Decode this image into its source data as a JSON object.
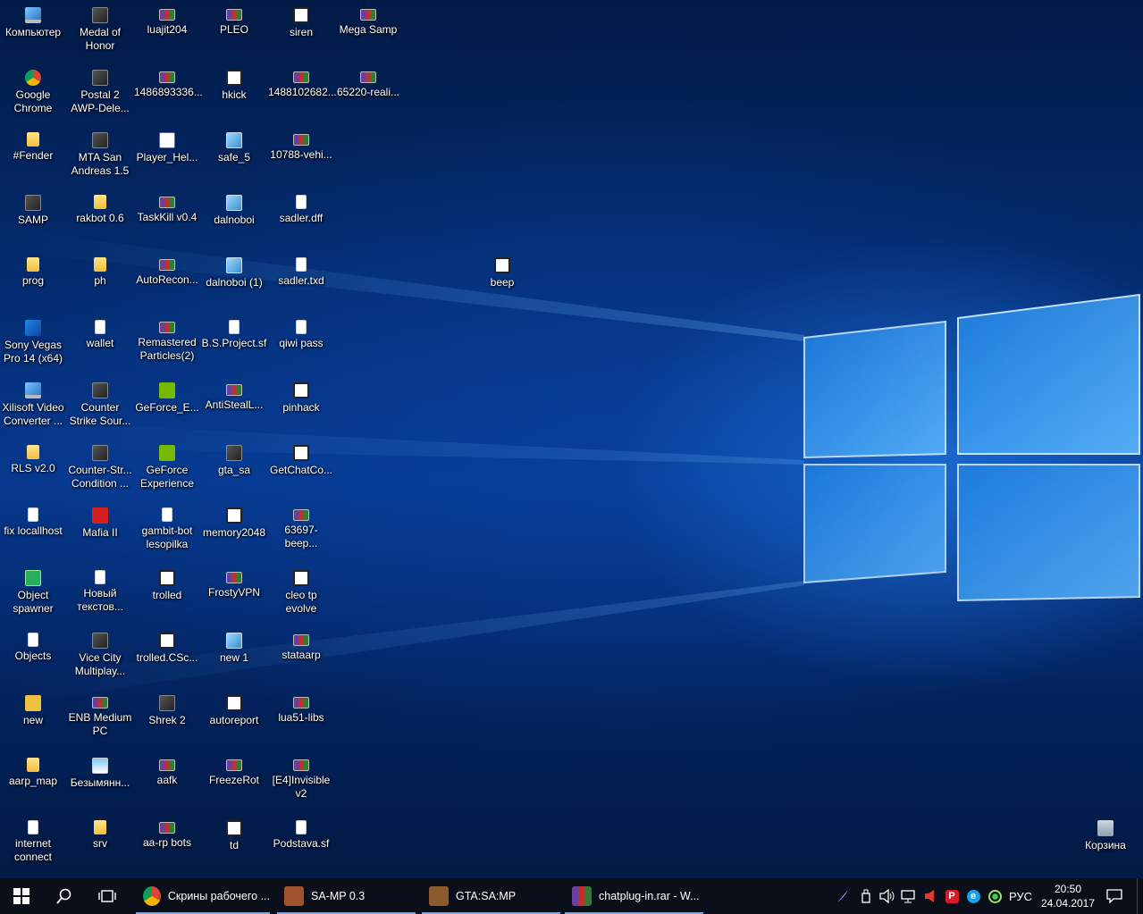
{
  "desktop": {
    "icons": [
      {
        "label": "Компьютер",
        "icon": "computer-icon"
      },
      {
        "label": "Google\nChrome",
        "icon": "chrome-icon"
      },
      {
        "label": "#Fender",
        "icon": "folder-special-icon"
      },
      {
        "label": "SAMP",
        "icon": "samp-game-icon"
      },
      {
        "label": "prog",
        "icon": "folder-icon"
      },
      {
        "label": "Sony Vegas\nPro 14 (x64)",
        "icon": "vegas-icon"
      },
      {
        "label": "Xilisoft Video\nConverter ...",
        "icon": "xilisoft-icon"
      },
      {
        "label": "RLS v2.0",
        "icon": "folder-icon"
      },
      {
        "label": "fix locallhost",
        "icon": "document-icon"
      },
      {
        "label": "Object\nspawner",
        "icon": "green-app-icon"
      },
      {
        "label": "Objects",
        "icon": "document-icon"
      },
      {
        "label": "new",
        "icon": "person-icon"
      },
      {
        "label": "aarp_map",
        "icon": "folder-icon"
      },
      {
        "label": "internet\nconnect",
        "icon": "document-icon"
      },
      {
        "label": "Medal of\nHonor",
        "icon": "game-icon"
      },
      {
        "label": "Postal 2\nAWP-Dele...",
        "icon": "game-icon"
      },
      {
        "label": "MTA San\nAndreas 1.5",
        "icon": "game-icon"
      },
      {
        "label": "rakbot 0.6",
        "icon": "folder-icon"
      },
      {
        "label": "ph",
        "icon": "folder-icon"
      },
      {
        "label": "wallet",
        "icon": "document-icon"
      },
      {
        "label": "Counter\nStrike Sour...",
        "icon": "cs-icon"
      },
      {
        "label": "Counter-Str...\nCondition ...",
        "icon": "cs-icon"
      },
      {
        "label": "Mafia II",
        "icon": "mafia-icon"
      },
      {
        "label": "Новый\nтекстов...",
        "icon": "document-icon"
      },
      {
        "label": "Vice City\nMultiplay...",
        "icon": "game-icon"
      },
      {
        "label": "ENB Medium\nPC",
        "icon": "rar-icon"
      },
      {
        "label": "Безымянн...",
        "icon": "image-icon"
      },
      {
        "label": "srv",
        "icon": "folder-icon"
      },
      {
        "label": "luajit204",
        "icon": "rar-icon"
      },
      {
        "label": "1486893336...",
        "icon": "rar-icon"
      },
      {
        "label": "Player_Hel...",
        "icon": "help-file-icon"
      },
      {
        "label": "TaskKill v0.4",
        "icon": "rar-icon"
      },
      {
        "label": "AutoRecon...",
        "icon": "rar-icon"
      },
      {
        "label": "Remastered\nParticles(2)",
        "icon": "rar-icon"
      },
      {
        "label": "GeForce_E...",
        "icon": "nvidia-icon"
      },
      {
        "label": "GeForce\nExperience",
        "icon": "nvidia-icon"
      },
      {
        "label": "gambit-bot\nlesopilka",
        "icon": "document-icon"
      },
      {
        "label": "trolled",
        "icon": "samp-icon"
      },
      {
        "label": "trolled.CSc...",
        "icon": "samp-icon"
      },
      {
        "label": "Shrek 2",
        "icon": "game-icon"
      },
      {
        "label": "aafk",
        "icon": "rar-icon"
      },
      {
        "label": "aa-rp bots",
        "icon": "rar-icon"
      },
      {
        "label": "PLEO",
        "icon": "rar-icon"
      },
      {
        "label": "hkick",
        "icon": "samp-icon"
      },
      {
        "label": "safe_5",
        "icon": "exe-icon"
      },
      {
        "label": "dalnoboi",
        "icon": "exe-icon"
      },
      {
        "label": "dalnoboi (1)",
        "icon": "exe-icon"
      },
      {
        "label": "B.S.Project.sf",
        "icon": "document-icon"
      },
      {
        "label": "AntiStealL...",
        "icon": "rar-icon"
      },
      {
        "label": "gta_sa",
        "icon": "gta-icon"
      },
      {
        "label": "memory2048",
        "icon": "samp-icon"
      },
      {
        "label": "FrostyVPN",
        "icon": "rar-icon"
      },
      {
        "label": "new 1",
        "icon": "exe-icon"
      },
      {
        "label": "autoreport",
        "icon": "samp-icon"
      },
      {
        "label": "FreezeRot",
        "icon": "rar-icon"
      },
      {
        "label": "td",
        "icon": "samp-icon"
      },
      {
        "label": "siren",
        "icon": "samp-icon"
      },
      {
        "label": "1488102682...",
        "icon": "rar-icon"
      },
      {
        "label": "10788-vehi...",
        "icon": "rar-icon"
      },
      {
        "label": "sadler.dff",
        "icon": "document-icon"
      },
      {
        "label": "sadler.txd",
        "icon": "document-icon"
      },
      {
        "label": "qiwi pass",
        "icon": "document-icon"
      },
      {
        "label": "pinhack",
        "icon": "samp-icon"
      },
      {
        "label": "GetChatCo...",
        "icon": "samp-icon"
      },
      {
        "label": "63697-beep...",
        "icon": "rar-icon"
      },
      {
        "label": "cleo tp\nevolve",
        "icon": "samp-icon"
      },
      {
        "label": "stataarp",
        "icon": "rar-icon"
      },
      {
        "label": "lua51-libs",
        "icon": "rar-icon"
      },
      {
        "label": "[E4]Invisible\nv2",
        "icon": "rar-icon"
      },
      {
        "label": "Podstava.sf",
        "icon": "document-icon"
      },
      {
        "label": "Mega Samp",
        "icon": "rar-icon"
      },
      {
        "label": "65220-reali...",
        "icon": "rar-icon"
      },
      {
        "label": "beep",
        "icon": "samp-icon"
      },
      {
        "label": "Корзина",
        "icon": "recycle-bin-icon"
      }
    ]
  },
  "taskbar": {
    "tasks": [
      {
        "label": "Скрины рабочего ...",
        "icon": "chrome-icon",
        "color": "#db4437"
      },
      {
        "label": "SA-MP 0.3",
        "icon": "samp-client-icon",
        "color": "#a0522d"
      },
      {
        "label": "GTA:SA:MP",
        "icon": "gta-icon",
        "color": "#8b5a2b"
      },
      {
        "label": "chatplug-in.rar - W...",
        "icon": "winrar-icon",
        "color": "#6b3fa0"
      }
    ],
    "language": "РУС",
    "time": "20:50",
    "date": "24.04.2017"
  }
}
